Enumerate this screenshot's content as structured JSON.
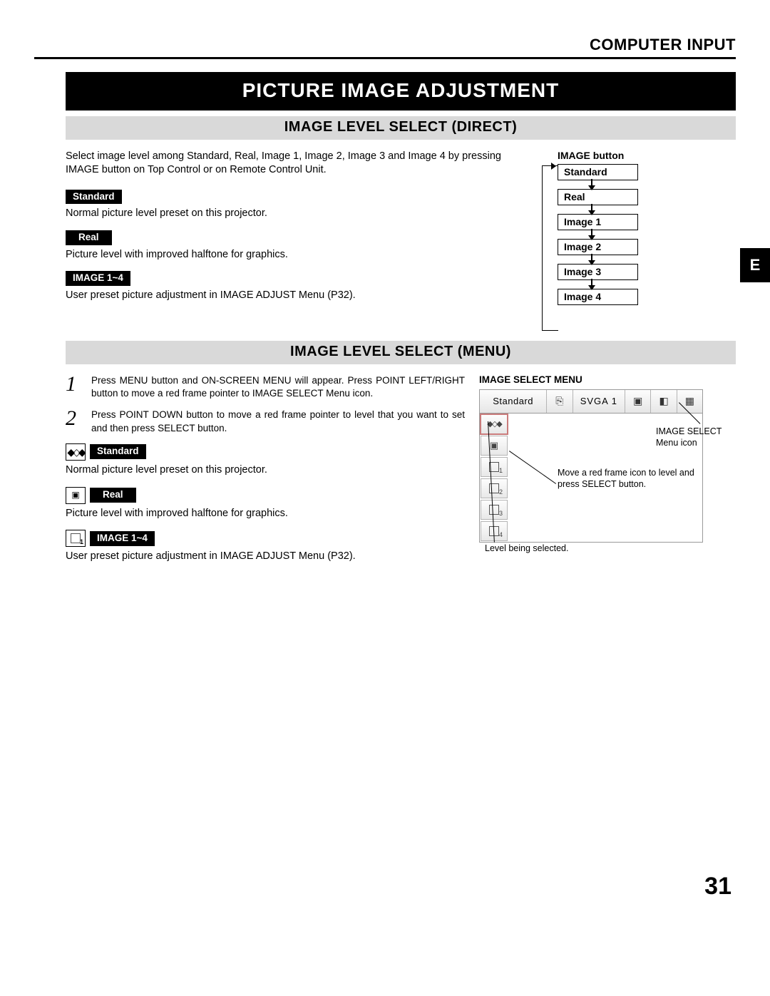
{
  "header": {
    "title": "COMPUTER INPUT"
  },
  "banners": {
    "main": "PICTURE IMAGE ADJUSTMENT",
    "sec1": "IMAGE LEVEL SELECT (DIRECT)",
    "sec2": "IMAGE LEVEL SELECT (MENU)"
  },
  "side_tab": "E",
  "sec1": {
    "intro": "Select image level among Standard, Real, Image 1, Image 2, Image 3 and Image 4 by pressing IMAGE button on Top Control or on Remote Control Unit.",
    "items": [
      {
        "label": "Standard",
        "desc": "Normal picture level preset on this projector."
      },
      {
        "label": "Real",
        "desc": "Picture level with improved halftone for graphics."
      },
      {
        "label": "IMAGE 1~4",
        "desc": "User preset picture adjustment in IMAGE ADJUST Menu (P32)."
      }
    ],
    "flow_title": "IMAGE button",
    "flow": [
      "Standard",
      "Real",
      "Image 1",
      "Image 2",
      "Image 3",
      "Image 4"
    ]
  },
  "sec2": {
    "steps": [
      "Press MENU button and ON-SCREEN MENU will appear.  Press POINT LEFT/RIGHT button to move a red frame pointer to IMAGE SELECT Menu icon.",
      "Press POINT DOWN button to move a red frame pointer to level that you want to set and then press SELECT button."
    ],
    "items": [
      {
        "label": "Standard",
        "desc": "Normal picture level preset on this projector."
      },
      {
        "label": "Real",
        "desc": "Picture level with improved halftone for graphics."
      },
      {
        "label": "IMAGE 1~4",
        "desc": "User preset picture adjustment in IMAGE ADJUST Menu (P32)."
      }
    ],
    "menu_title": "IMAGE SELECT MENU",
    "osd_label": "Standard",
    "osd_mode": "SVGA 1",
    "callout_icon": "IMAGE SELECT Menu icon",
    "callout_move": "Move a red frame icon to level and press SELECT button.",
    "callout_level": "Level being selected."
  },
  "page_number": "31"
}
